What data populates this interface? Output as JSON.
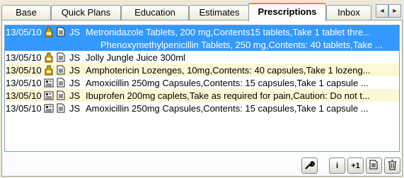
{
  "tabs": [
    {
      "label": "Base"
    },
    {
      "label": "Quick Plans"
    },
    {
      "label": "Education"
    },
    {
      "label": "Estimates"
    },
    {
      "label": "Prescriptions"
    },
    {
      "label": "Inbox"
    }
  ],
  "active_tab": "Prescriptions",
  "tab_scroll": {
    "left": "◄",
    "right": "►"
  },
  "rows": [
    {
      "date": "13/05/10",
      "icon": "bottle-icon",
      "author": "JS",
      "desc": "Metronidazole Tablets, 200 mg,Contents15 tablets,Take 1 tablet thre..."
    },
    {
      "date": "",
      "icon": "",
      "author": "",
      "desc": "Phenoxymethylpenicillin Tablets, 250 mg,Contents: 40 tablets,Take ..."
    },
    {
      "date": "13/05/10",
      "icon": "bottle-icon",
      "author": "JS",
      "desc": "Jolly Jungle Juice 300ml"
    },
    {
      "date": "13/05/10",
      "icon": "bottle-icon",
      "author": "JS",
      "desc": "Amphotericin Lozenges, 10mg,Contents: 40 capsules,Take 1 lozeng..."
    },
    {
      "date": "13/05/10",
      "icon": "form-icon",
      "author": "JS",
      "desc": "Amoxicillin 250mg Capsules,Contents: 15 capsules,Take 1 capsule ..."
    },
    {
      "date": "13/05/10",
      "icon": "form-icon",
      "author": "JS",
      "desc": "Ibuprofen 200mg caplets,Take as required for pain,Caution: Do not t..."
    },
    {
      "date": "13/05/10",
      "icon": "form-icon",
      "author": "JS",
      "desc": "Amoxicillin 250mg Capsules,Contents: 15 capsules,Take 1 capsule ..."
    }
  ],
  "toolbar": {
    "tools_icon": "wrench-icon",
    "info_label": "i",
    "add_one_label": "+1",
    "print_icon": "print-icon",
    "delete_icon": "trash-icon"
  }
}
